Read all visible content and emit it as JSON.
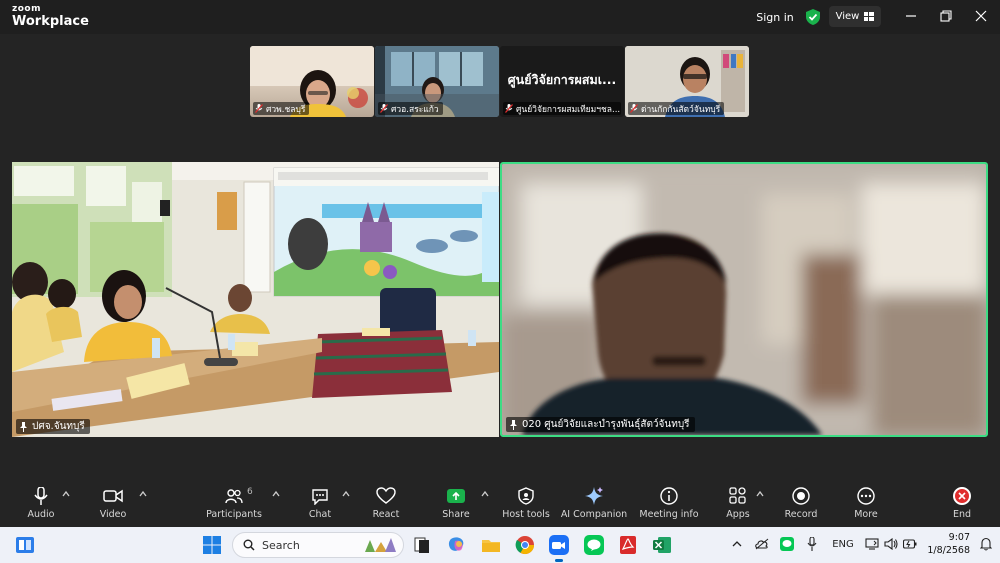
{
  "app": {
    "brand_top": "zoom",
    "brand_bottom": "Workplace"
  },
  "titlebar": {
    "signin_label": "Sign in",
    "view_label": "View",
    "secure_color": "#1ab24c"
  },
  "gallery": [
    {
      "name": "ศวพ.ชลบุรี",
      "muted": true
    },
    {
      "name": "ศวอ.สระแก้ว",
      "muted": true
    },
    {
      "name": "ศูนย์วิจัยการผสมเทียมฯชล...",
      "muted": true,
      "big_text": "ศูนย์วิจัยการผสมเ..."
    },
    {
      "name": "ด่านกักกันสัตว์จันทบุรี",
      "muted": true
    }
  ],
  "main_videos": [
    {
      "name": "ปศจ.จันทบุรี",
      "active": false
    },
    {
      "name": "020 ศูนย์วิจัยและบำรุงพันธุ์สัตว์จันทบุรี",
      "active": true,
      "active_color": "#3ddc84"
    }
  ],
  "toolbar": {
    "audio": "Audio",
    "video": "Video",
    "participants": "Participants",
    "participants_count": "6",
    "chat": "Chat",
    "react": "React",
    "share": "Share",
    "host_tools": "Host tools",
    "ai_companion": "AI Companion",
    "meeting_info": "Meeting info",
    "apps": "Apps",
    "record": "Record",
    "more": "More",
    "end": "End",
    "share_color": "#1ab24c",
    "end_color": "#e02e2e"
  },
  "taskbar": {
    "search_placeholder": "Search",
    "language": "ENG",
    "time": "9:07",
    "date": "1/8/2568"
  }
}
